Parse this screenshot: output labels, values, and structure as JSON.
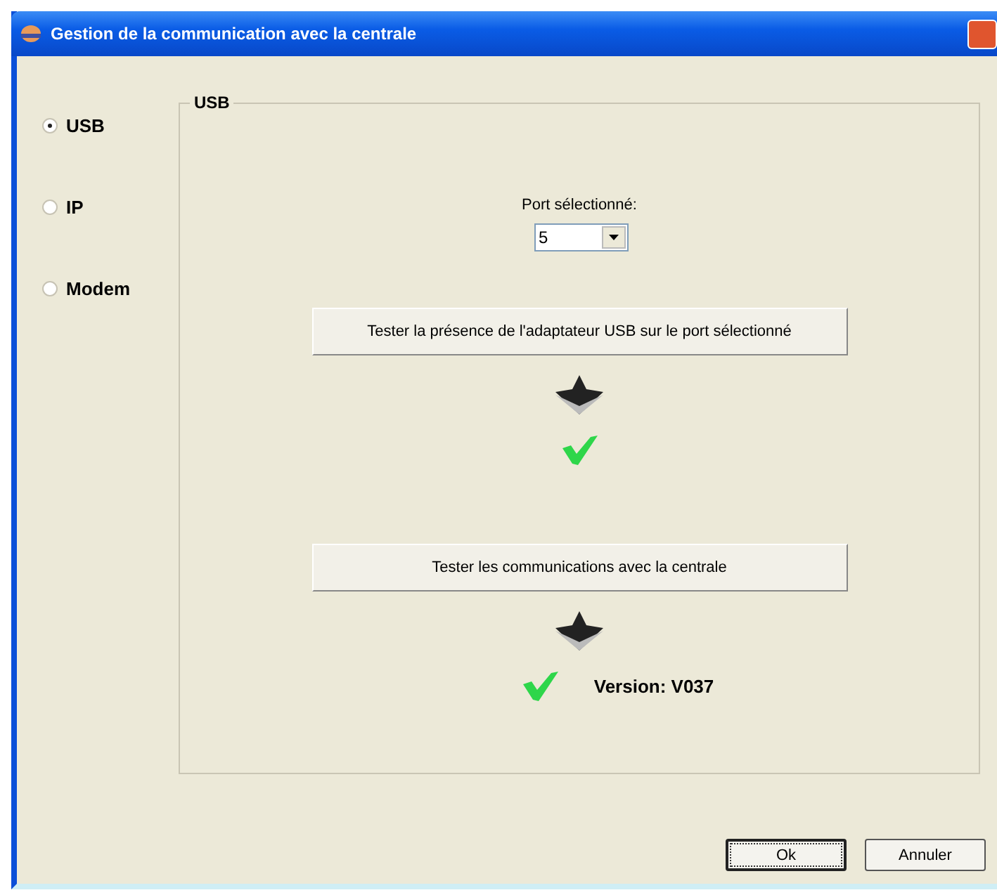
{
  "window": {
    "title": "Gestion de la communication avec la centrale"
  },
  "connections": [
    {
      "label": "USB",
      "selected": true
    },
    {
      "label": "IP",
      "selected": false
    },
    {
      "label": "Modem",
      "selected": false
    }
  ],
  "group": {
    "title": "USB",
    "port_label": "Port sélectionné:",
    "port_value": "5"
  },
  "tests": [
    {
      "button": "Tester la présence de l'adaptateur USB sur le port sélectionné",
      "passed": true
    },
    {
      "button": "Tester les communications avec la centrale",
      "passed": true,
      "detail": "Version: V037"
    }
  ],
  "buttons": [
    {
      "label": "Ok",
      "default": true
    },
    {
      "label": "Annuler",
      "default": false
    }
  ]
}
